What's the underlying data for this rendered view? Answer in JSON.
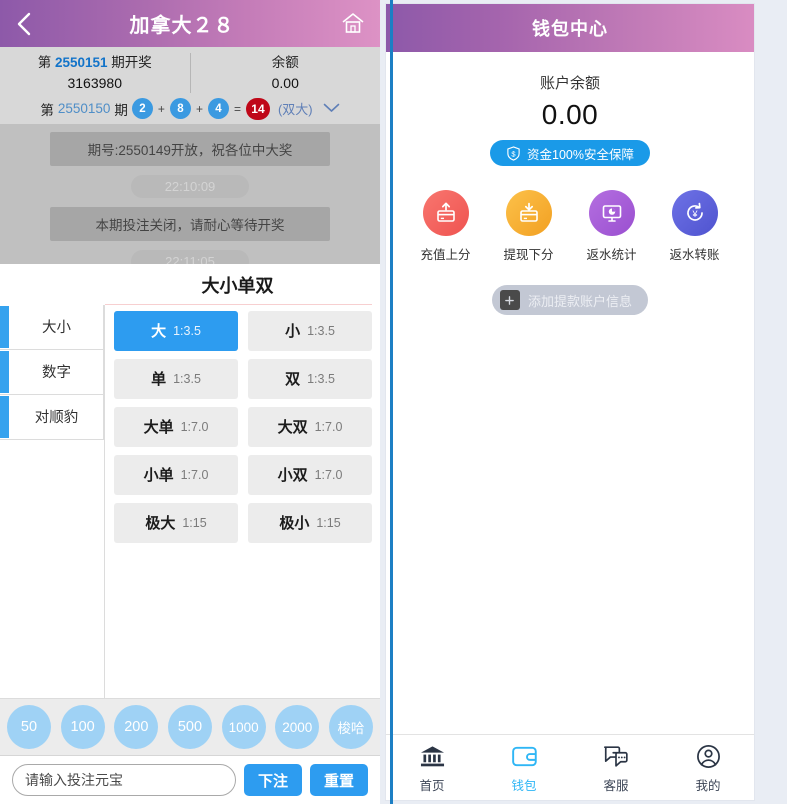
{
  "game": {
    "header": {
      "back_icon": "chevron-left-icon",
      "title": "加拿大２８",
      "home_icon": "home-icon"
    },
    "info": {
      "draw_prefix": "第",
      "draw_issue": "2550151",
      "draw_suffix": "期开奖",
      "draw_value": "3163980",
      "balance_label": "余额",
      "balance_value": "0.00",
      "prev_prefix": "第",
      "prev_issue": "2550150",
      "prev_suffix": "期",
      "prev_balls": [
        "2",
        "8",
        "4"
      ],
      "op_plus": "+",
      "op_equals": "=",
      "prev_sum": "14",
      "prev_tag": "(双大)",
      "caret_icon": "chevron-down-icon"
    },
    "chat": {
      "messages": [
        {
          "type": "bubble",
          "text": "期号:2550149开放，祝各位中大奖"
        },
        {
          "type": "time",
          "text": "22:10:09"
        },
        {
          "type": "bubble",
          "text": "本期投注关闭，请耐心等待开奖"
        },
        {
          "type": "time",
          "text": "22:11:05"
        }
      ]
    },
    "play": {
      "title": "大小单双",
      "side_tabs": [
        {
          "label": "大小"
        },
        {
          "label": "数字"
        },
        {
          "label": "对顺豹"
        }
      ],
      "bets": [
        {
          "name": "大",
          "odds": "1:3.5",
          "selected": true
        },
        {
          "name": "小",
          "odds": "1:3.5",
          "selected": false
        },
        {
          "name": "单",
          "odds": "1:3.5",
          "selected": false
        },
        {
          "name": "双",
          "odds": "1:3.5",
          "selected": false
        },
        {
          "name": "大单",
          "odds": "1:7.0",
          "selected": false
        },
        {
          "name": "大双",
          "odds": "1:7.0",
          "selected": false
        },
        {
          "name": "小单",
          "odds": "1:7.0",
          "selected": false
        },
        {
          "name": "小双",
          "odds": "1:7.0",
          "selected": false
        },
        {
          "name": "极大",
          "odds": "1:15",
          "selected": false
        },
        {
          "name": "极小",
          "odds": "1:15",
          "selected": false
        }
      ]
    },
    "chips": [
      "50",
      "100",
      "200",
      "500",
      "1000",
      "2000",
      "梭哈"
    ],
    "bet_bar": {
      "input_placeholder": "请输入投注元宝",
      "input_value": "",
      "submit_label": "下注",
      "reset_label": "重置"
    }
  },
  "wallet": {
    "header_title": "钱包中心",
    "balance_label": "账户余额",
    "balance_value": "0.00",
    "safe_badge": {
      "icon": "shield-dollar-icon",
      "text": "资金100%安全保障"
    },
    "actions": [
      {
        "label": "充值上分",
        "icon": "card-up-icon",
        "color": "#f4645f"
      },
      {
        "label": "提现下分",
        "icon": "card-down-icon",
        "color": "#f5a623"
      },
      {
        "label": "返水统计",
        "icon": "monitor-chart-icon",
        "color": "#a85fd8"
      },
      {
        "label": "返水转账",
        "icon": "yuan-refresh-icon",
        "color": "#5b5fd8"
      }
    ],
    "add_account": {
      "icon": "plus-square-icon",
      "label": "添加提款账户信息"
    },
    "tabs": [
      {
        "label": "首页",
        "icon": "bank-icon",
        "active": false
      },
      {
        "label": "钱包",
        "icon": "wallet-icon",
        "active": true
      },
      {
        "label": "客服",
        "icon": "chat-icon",
        "active": false
      },
      {
        "label": "我的",
        "icon": "user-icon",
        "active": false
      }
    ]
  },
  "colors": {
    "header_gradient_start": "#8d59a9",
    "header_gradient_end": "#dd92c5",
    "accent_blue": "#2d9cf0",
    "chip_blue": "#9fd2f5",
    "sum_red": "#bf0718"
  }
}
